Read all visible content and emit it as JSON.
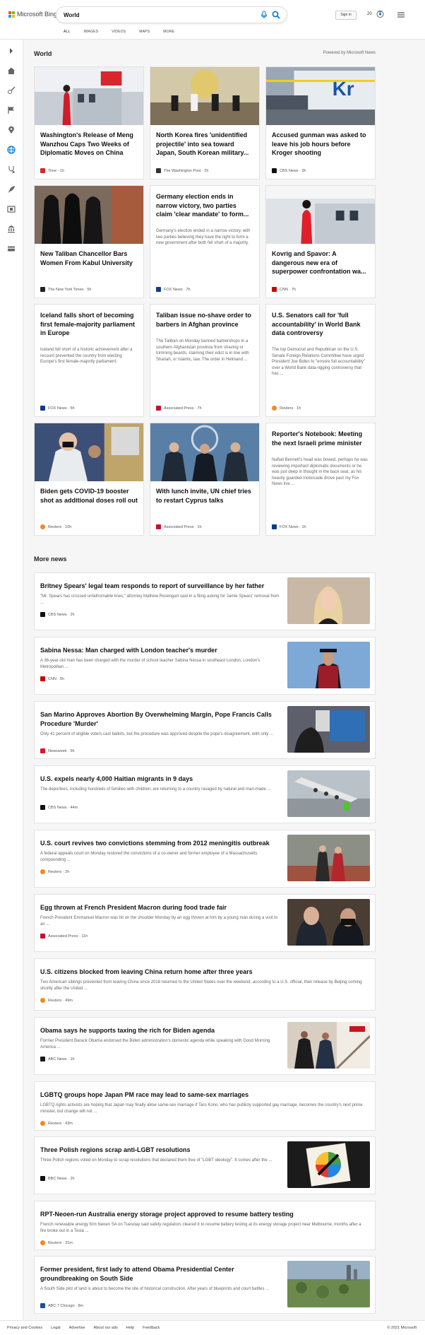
{
  "header": {
    "brand": "Microsoft Bing",
    "search_value": "World",
    "signin_label": "Sign in",
    "reward_points": "20",
    "tabs": [
      "ALL",
      "IMAGES",
      "VIDEOS",
      "MAPS",
      "MORE"
    ],
    "colors": {
      "logo_red": "#f25022",
      "logo_green": "#7fba00",
      "logo_blue": "#00a4ef",
      "logo_yellow": "#ffb900",
      "accent": "#0078d4"
    }
  },
  "rail": {
    "icons": [
      "expand-icon",
      "home-icon",
      "sports-icon",
      "flag-icon",
      "location-pin-icon",
      "globe-icon",
      "stethoscope-icon",
      "rocket-icon",
      "film-icon",
      "bank-icon",
      "card-icon"
    ]
  },
  "world": {
    "title": "World",
    "powered_by": "Powered by Microsoft News",
    "cards": [
      {
        "title": "Washington's Release of Meng Wanzhou Caps Two Weeks of Diplomatic Moves on China",
        "source": "Time",
        "time": "1h"
      },
      {
        "title": "North Korea fires 'unidentified projectile' into sea toward Japan, South Korean military...",
        "source": "The Washington Post",
        "time": "2h"
      },
      {
        "title": "Accused gunman was asked to leave his job hours before Kroger shooting",
        "source": "CBS News",
        "time": "3h"
      },
      {
        "title": "New Taliban Chancellor Bars Women From Kabul University",
        "source": "The New York Times",
        "time": "5h"
      },
      {
        "title": "Germany election ends in narrow victory, two parties claim 'clear mandate' to form...",
        "desc": "Germany's election ended in a narrow victory, with two parties believing they have the right to form a new government after both fell short of a majority.",
        "source": "FOX News",
        "time": "7h"
      },
      {
        "title": "Kovrig and Spavor: A dangerous new era of superpower confrontation wa...",
        "source": "CNN",
        "time": "7h"
      },
      {
        "title": "Iceland falls short of becoming first female-majority parliament in Europe",
        "desc": "Iceland fell short of a historic achievement after a recount prevented the country from electing Europe's first female-majority parliament.",
        "source": "FOX News",
        "time": "5h"
      },
      {
        "title": "Taliban issue no-shave order to barbers in Afghan province",
        "desc": "The Taliban on Monday banned barbershops in a southern Afghanistan province from shaving or trimming beards, claiming their edict is in line with Shariah, or Islamic, law. The order in Helmand ...",
        "source": "Associated Press",
        "time": "7h"
      },
      {
        "title": "U.S. Senators call for 'full accountability' in World Bank data controversy",
        "desc": "The top Democrat and Republican on the U.S. Senate Foreign Relations Committee have urged President Joe Biden to \"ensure full accountability\" over a World Bank data-rigging controversy that has ...",
        "source": "Reuters",
        "time": "1h"
      },
      {
        "title": "Biden gets COVID-19 booster shot as additional doses roll out",
        "source": "Reuters",
        "time": "10h"
      },
      {
        "title": "With lunch invite, UN chief tries to restart Cyprus talks",
        "source": "Associated Press",
        "time": "1h"
      },
      {
        "title": "Reporter's Notebook: Meeting the next Israeli prime minister",
        "desc": "Naftali Bennett's head was bowed, perhaps he was reviewing important diplomatic documents or he was just deep in thought in the back seat, as his heavily guarded motorcade drove past my Fox News live ...",
        "source": "FOX News",
        "time": "1h"
      }
    ]
  },
  "more_news": {
    "title": "More news",
    "items": [
      {
        "title": "Britney Spears' legal team responds to report of surveillance by her father",
        "desc": "\"Mr. Spears has crossed unfathomable lines,\" attorney Mathew Rosengart said in a filing asking for Jamie Spears' removal from ...",
        "source": "CBS News",
        "time": "2h"
      },
      {
        "title": "Sabina Nessa: Man charged with London teacher's murder",
        "desc": "A 36-year-old man has been charged with the murder of school teacher Sabina Nessa in southeast London, London's Metropolitan ...",
        "source": "CNN",
        "time": "5h"
      },
      {
        "title": "San Marino Approves Abortion By Overwhelming Margin, Pope Francis Calls Procedure 'Murder'",
        "desc": "Only 41 percent of eligible voters cast ballots, but the procedure was approved despite the pope's disagreement, with only ...",
        "source": "Newsweek",
        "time": "5h"
      },
      {
        "title": "U.S. expels nearly 4,000 Haitian migrants in 9 days",
        "desc": "The deportees, including hundreds of families with children, are returning to a country ravaged by natural and man-made ...",
        "source": "CBS News",
        "time": "44m"
      },
      {
        "title": "U.S. court revives two convictions stemming from 2012 meningitis outbreak",
        "desc": "A federal appeals court on Monday restored the convictions of a co-owner and former employee of a Massachusetts compounding ...",
        "source": "Reuters",
        "time": "2h"
      },
      {
        "title": "Egg thrown at French President Macron during food trade fair",
        "desc": "French President Emmanuel Macron was hit on the shoulder Monday by an egg thrown at him by a young man during a visit to an ...",
        "source": "Associated Press",
        "time": "11h"
      },
      {
        "title": "U.S. citizens blocked from leaving China return home after three years",
        "desc": "Two American siblings prevented from leaving China since 2018 returned to the United States over the weekend, according to a U.S. official, their release by Beijing coming shortly after the United ...",
        "source": "Reuters",
        "time": "49m"
      },
      {
        "title": "Obama says he supports taxing the rich for Biden agenda",
        "desc": "Former President Barack Obama endorsed the Biden administration's domestic agenda while speaking with Good Morning America ...",
        "source": "ABC News",
        "time": "1h"
      },
      {
        "title": "LGBTQ groups hope Japan PM race may lead to same-sex marriages",
        "desc": "LGBTQ rights activists are hoping that Japan may finally allow same-sex marriage if Taro Kono, who has publicly supported gay marriage, becomes the country's next prime minister, but change will not ...",
        "source": "Reuters",
        "time": "43m"
      },
      {
        "title": "Three Polish regions scrap anti-LGBT resolutions",
        "desc": "Three Polish regions voted on Monday to scrap resolutions that declared them free of \"LGBT ideology\". It comes after the ...",
        "source": "BBC News",
        "time": "2h"
      },
      {
        "title": "RPT-Neoen-run Australia energy storage project approved to resume battery testing",
        "desc": "French renewable energy firm Neoen SA on Tuesday said safety regulators cleared it to resume battery testing at its energy storage project near Melbourne, months after a fire broke out in a Tesla ...",
        "source": "Reuters",
        "time": "31m"
      },
      {
        "title": "Former president, first lady to attend Obama Presidential Center groundbreaking on South Side",
        "desc": "A South Side plot of land is about to become the site of historical construction. After years of blueprints and court battles ...",
        "source": "ABC 7 Chicago",
        "time": "8m"
      }
    ]
  },
  "footer": {
    "links": [
      "Privacy and Cookies",
      "Legal",
      "Advertise",
      "About our ads",
      "Help",
      "Feedback"
    ],
    "copyright": "© 2021 Microsoft"
  }
}
